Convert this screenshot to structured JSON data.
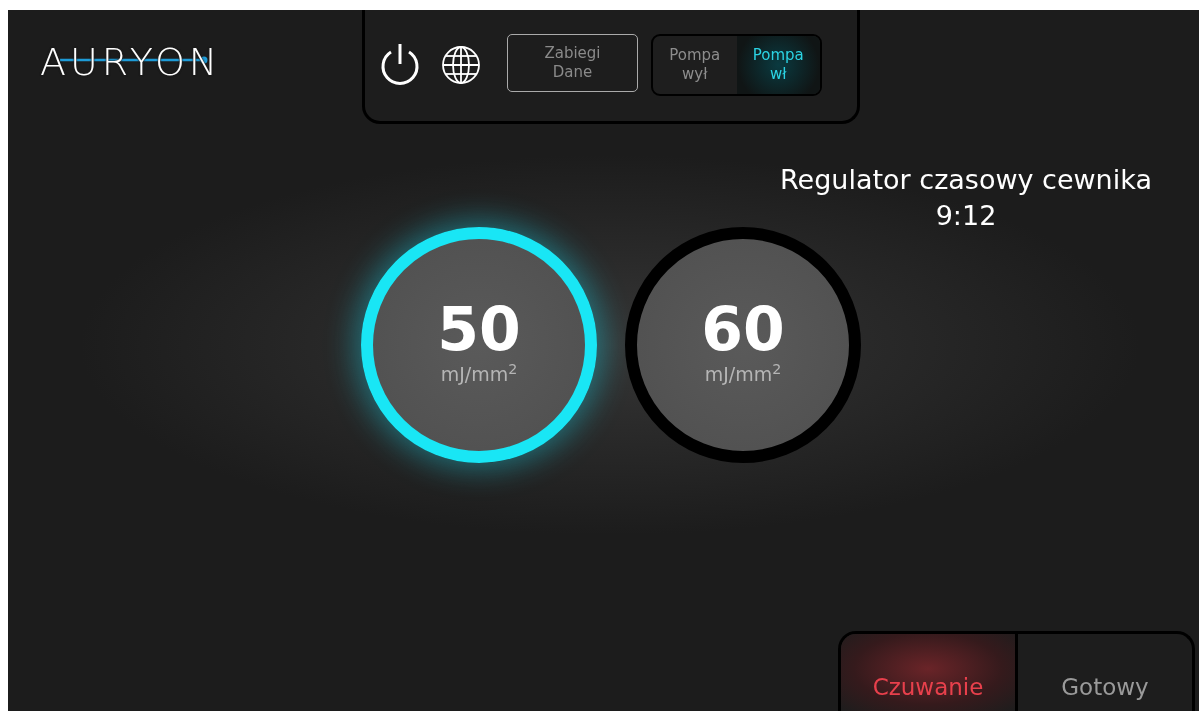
{
  "logo": {
    "text": "AURYON"
  },
  "toolbar": {
    "menu_button": {
      "label": "Zabiegi\nDane"
    },
    "pump_toggle": [
      {
        "label": "Pompa\nwył",
        "selected": false
      },
      {
        "label": "Pompa\nwł",
        "selected": true
      }
    ]
  },
  "timer": {
    "title": "Regulator czasowy cewnika",
    "value": "9:12"
  },
  "doses": [
    {
      "value": "50",
      "unit": "mJ/mm$^{2}$",
      "selected": true
    },
    {
      "value": "60",
      "unit": "mJ/mm$^{2}$",
      "selected": false
    }
  ],
  "mode_toggle": [
    {
      "label": "Czuwanie",
      "selected": true
    },
    {
      "label": "Gotowy",
      "selected": false
    }
  ]
}
